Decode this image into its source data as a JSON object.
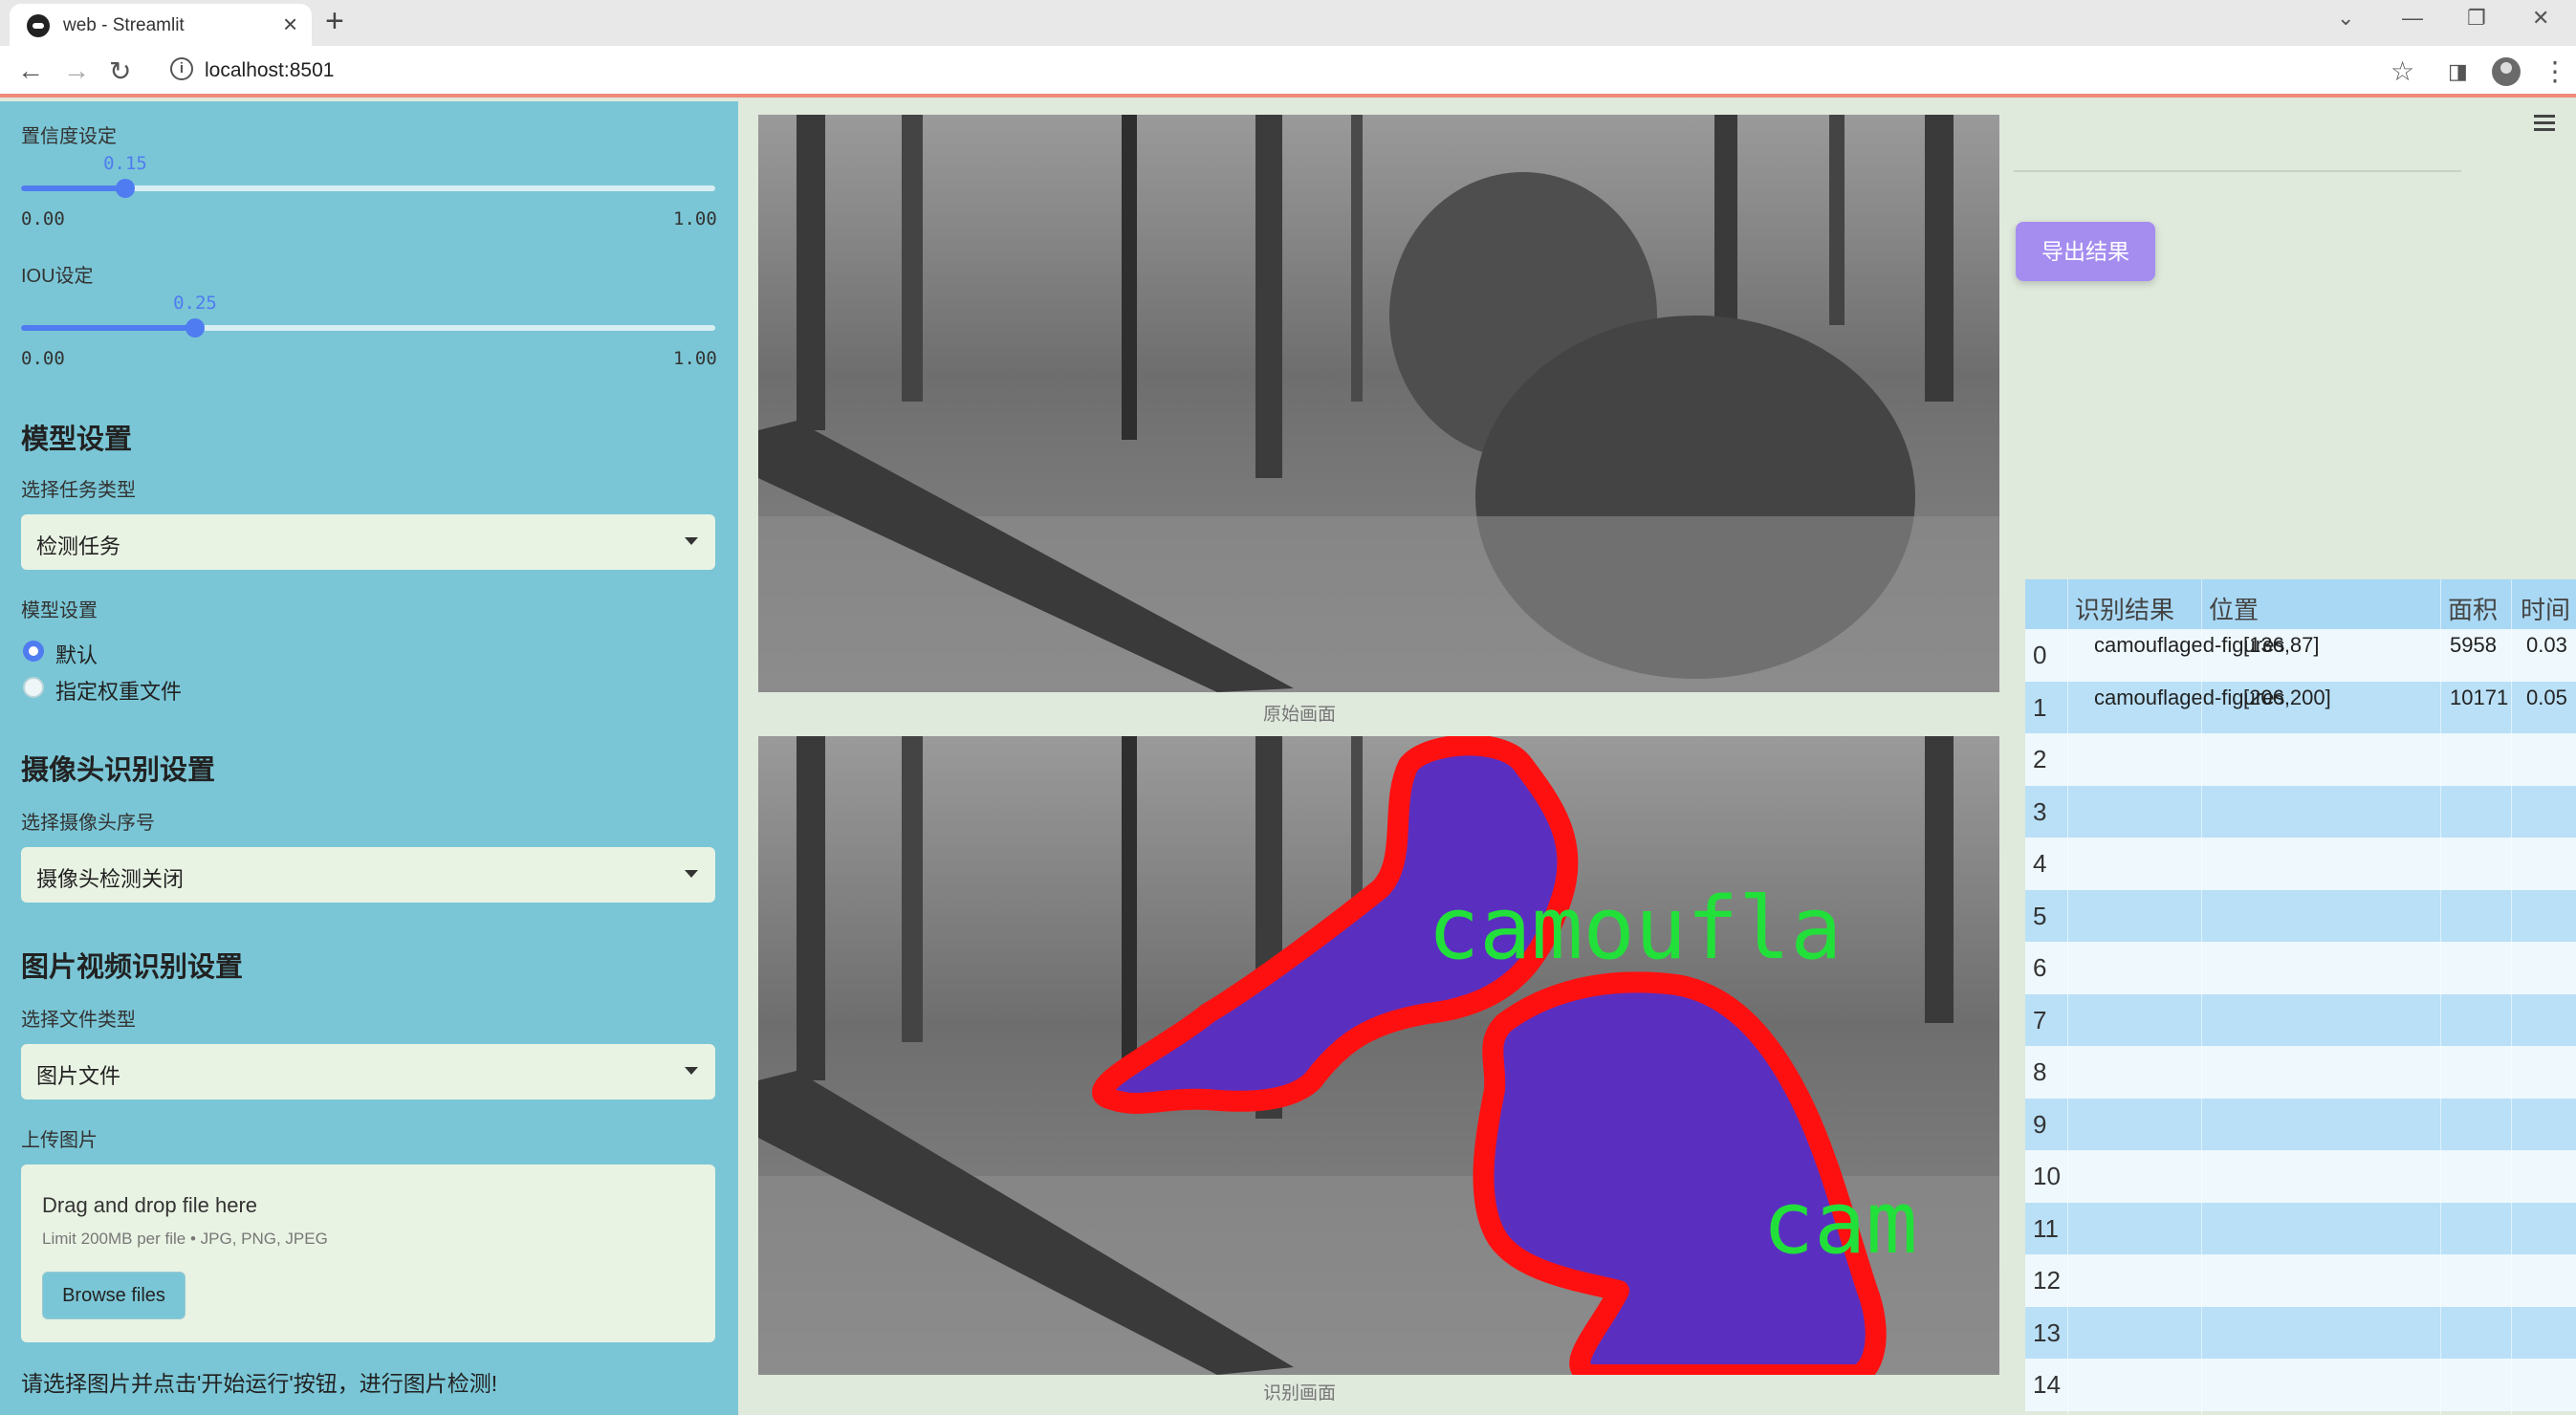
{
  "browser": {
    "tab_title": "web - Streamlit",
    "url": "localhost:8501"
  },
  "sidebar": {
    "confidence": {
      "label": "置信度设定",
      "value": "0.15",
      "value_num": 0.15,
      "min": "0.00",
      "max": "1.00"
    },
    "iou": {
      "label": "IOU设定",
      "value": "0.25",
      "value_num": 0.25,
      "min": "0.00",
      "max": "1.00"
    },
    "model_heading": "模型设置",
    "task_label": "选择任务类型",
    "task_value": "检测任务",
    "model_label": "模型设置",
    "model_options": [
      "默认",
      "指定权重文件"
    ],
    "camera_heading": "摄像头识别设置",
    "camera_label": "选择摄像头序号",
    "camera_value": "摄像头检测关闭",
    "media_heading": "图片视频识别设置",
    "filetype_label": "选择文件类型",
    "filetype_value": "图片文件",
    "upload_label": "上传图片",
    "upload_title": "Drag and drop file here",
    "upload_limit": "Limit 200MB per file • JPG, PNG, JPEG",
    "browse_label": "Browse files",
    "hint": "请选择图片并点击'开始运行'按钮，进行图片检测!"
  },
  "main": {
    "original_caption": "原始画面",
    "result_caption": "识别画面",
    "overlay_text_1": "camoufla",
    "overlay_text_2": "cam"
  },
  "right": {
    "export_label": "导出结果",
    "table": {
      "headers": [
        "识别结果",
        "位置",
        "面积",
        "时间"
      ],
      "rows": [
        {
          "idx": "0",
          "result": "camouflaged-figures",
          "pos": "[136,87]",
          "area": "5958",
          "time": "0.03"
        },
        {
          "idx": "1",
          "result": "camouflaged-figures",
          "pos": "[206,200]",
          "area": "10171",
          "time": "0.05"
        },
        {
          "idx": "2"
        },
        {
          "idx": "3"
        },
        {
          "idx": "4"
        },
        {
          "idx": "5"
        },
        {
          "idx": "6"
        },
        {
          "idx": "7"
        },
        {
          "idx": "8"
        },
        {
          "idx": "9"
        },
        {
          "idx": "10"
        },
        {
          "idx": "11"
        },
        {
          "idx": "12"
        },
        {
          "idx": "13"
        },
        {
          "idx": "14"
        }
      ]
    }
  },
  "colors": {
    "sidebar": "#7ac6d6",
    "accent": "#4f7cf0",
    "export": "#a58df0",
    "mask_outline": "#ff1010",
    "mask_fill": "#5a2fc0",
    "label_green": "#22e03a"
  }
}
